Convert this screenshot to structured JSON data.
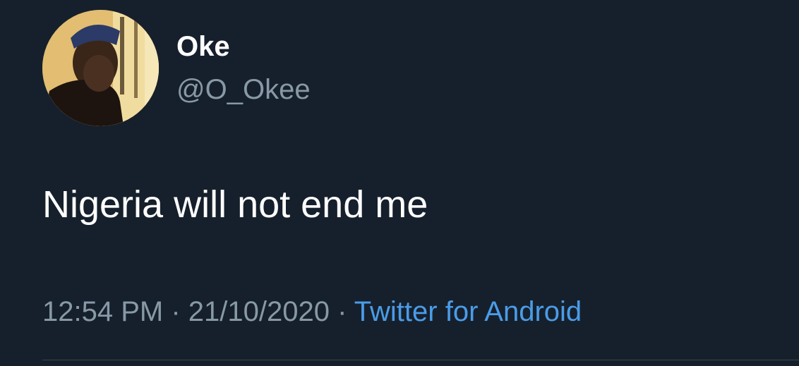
{
  "tweet": {
    "author": {
      "display_name": "Oke",
      "handle": "@O_Okee",
      "avatar_icon": "profile-photo"
    },
    "text": "Nigeria will not end me",
    "meta": {
      "time": "12:54 PM",
      "separator": " · ",
      "date": "21/10/2020",
      "source": "Twitter for Android"
    }
  },
  "colors": {
    "background": "#16202c",
    "primary_text": "#ffffff",
    "secondary_text": "#8899a6",
    "link": "#4a9ce8",
    "divider": "#38444d"
  }
}
